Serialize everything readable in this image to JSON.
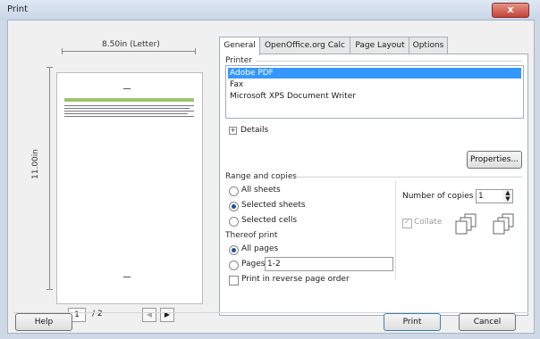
{
  "window": {
    "title": "Print",
    "close_label": "x"
  },
  "preview": {
    "paper_width_label": "8.50in (Letter)",
    "paper_height_label": "11.00in",
    "current_page": "1",
    "total_pages": "/ 2"
  },
  "tabs": [
    {
      "label": "General"
    },
    {
      "label": "OpenOffice.org Calc"
    },
    {
      "label": "Page Layout"
    },
    {
      "label": "Options"
    }
  ],
  "printer": {
    "group_label": "Printer",
    "items": [
      "Adobe PDF",
      "Fax",
      "Microsoft XPS Document Writer"
    ],
    "selected": "Adobe PDF",
    "details_label": "Details",
    "properties_label": "Properties..."
  },
  "range": {
    "group_label": "Range and copies",
    "all_sheets": "All sheets",
    "selected_sheets": "Selected sheets",
    "selected_cells": "Selected cells",
    "copies_label": "Number of copies",
    "copies_value": "1",
    "collate_label": "Collate"
  },
  "thereof": {
    "group_label": "Thereof print",
    "all_pages": "All pages",
    "pages": "Pages",
    "pages_value": "1-2",
    "reverse_label": "Print in reverse page order"
  },
  "footer": {
    "help": "Help",
    "print": "Print",
    "cancel": "Cancel"
  }
}
